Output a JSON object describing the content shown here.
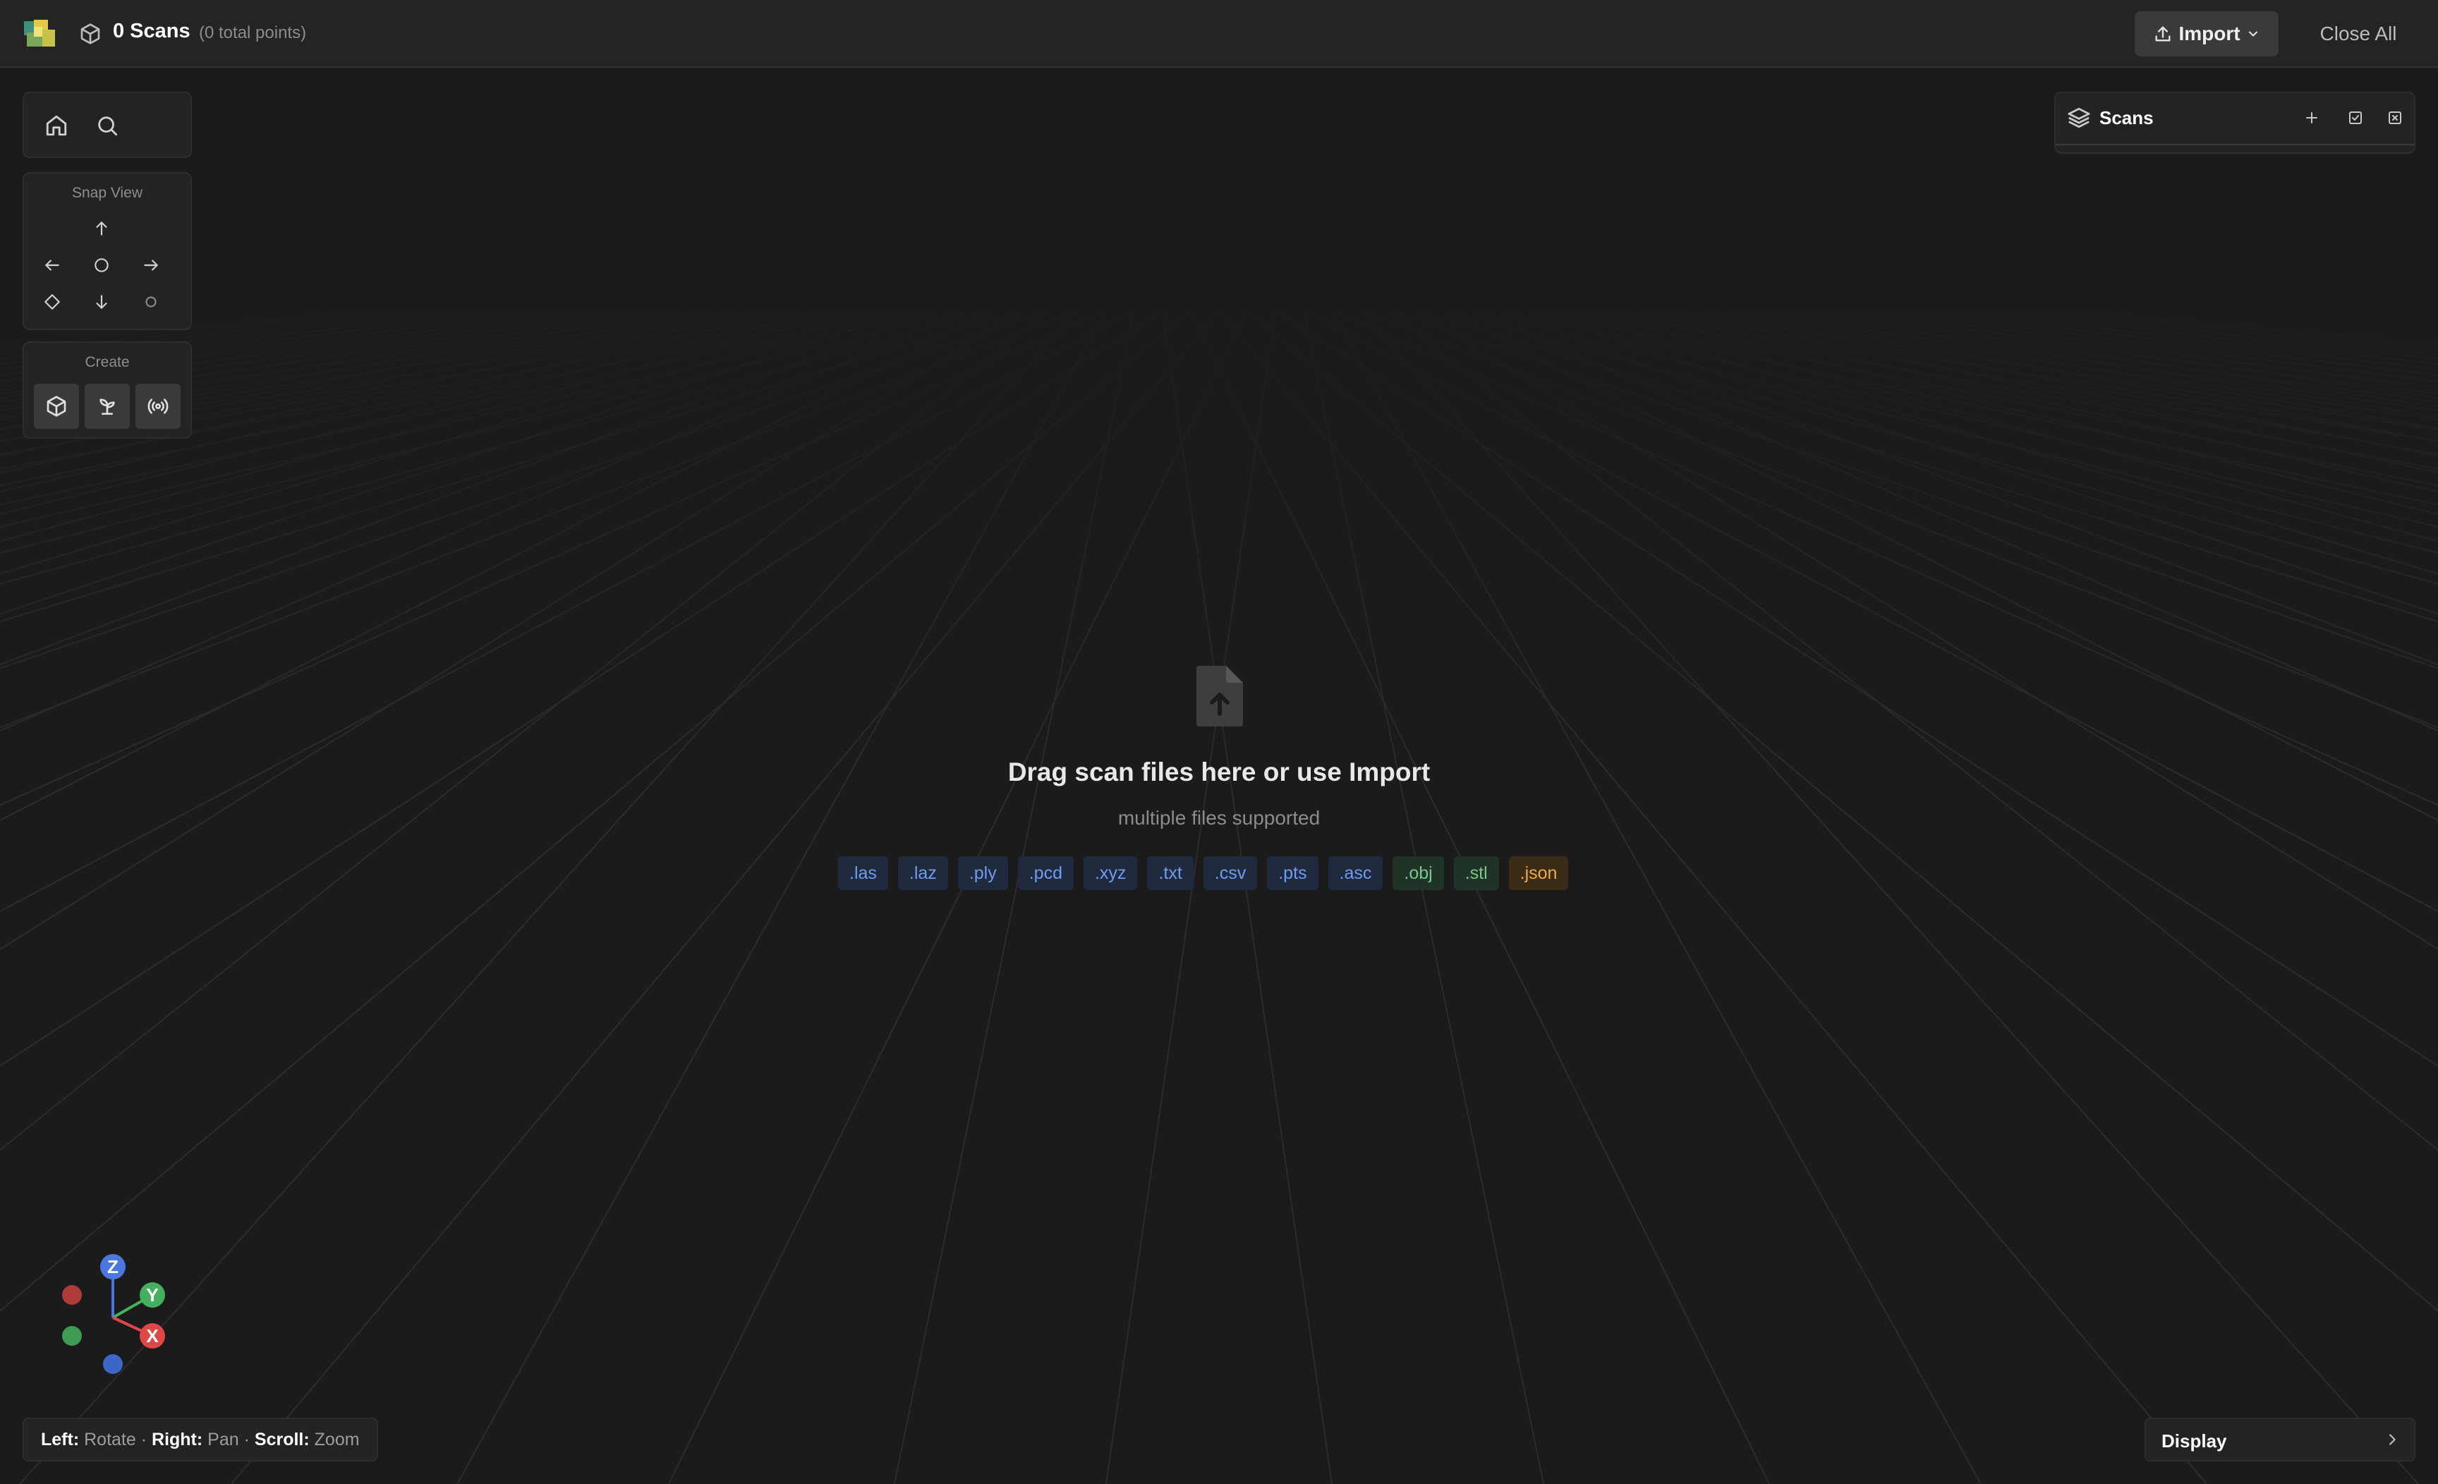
{
  "topbar": {
    "scan_title": "0 Scans",
    "scan_subtitle": "(0 total points)",
    "import_label": "Import",
    "close_all_label": "Close All"
  },
  "left_panels": {
    "snap_view_label": "Snap View",
    "create_label": "Create"
  },
  "scans_panel": {
    "title": "Scans"
  },
  "drop_zone": {
    "title": "Drag scan files here or use Import",
    "subtitle": "multiple files supported",
    "extensions": [
      {
        "label": ".las",
        "tone": "blue"
      },
      {
        "label": ".laz",
        "tone": "blue"
      },
      {
        "label": ".ply",
        "tone": "blue"
      },
      {
        "label": ".pcd",
        "tone": "blue"
      },
      {
        "label": ".xyz",
        "tone": "blue"
      },
      {
        "label": ".txt",
        "tone": "blue"
      },
      {
        "label": ".csv",
        "tone": "blue"
      },
      {
        "label": ".pts",
        "tone": "blue"
      },
      {
        "label": ".asc",
        "tone": "blue"
      },
      {
        "label": ".obj",
        "tone": "green"
      },
      {
        "label": ".stl",
        "tone": "green"
      },
      {
        "label": ".json",
        "tone": "amber"
      }
    ]
  },
  "gizmo": {
    "z_label": "Z",
    "y_label": "Y",
    "x_label": "X",
    "colors": {
      "x": "#e04848",
      "y": "#45b060",
      "z": "#4a78e0"
    }
  },
  "hint": {
    "left_key": "Left:",
    "left_action": "Rotate",
    "right_key": "Right:",
    "right_action": "Pan",
    "scroll_key": "Scroll:",
    "scroll_action": "Zoom",
    "separator": "·"
  },
  "display": {
    "label": "Display"
  },
  "icons": {
    "logo": "app-logo-icon",
    "scan_count": "cube-icon",
    "import": "upload-icon",
    "home": "home-icon",
    "search": "search-icon",
    "layers": "layers-icon",
    "drop": "file-upload-icon"
  }
}
